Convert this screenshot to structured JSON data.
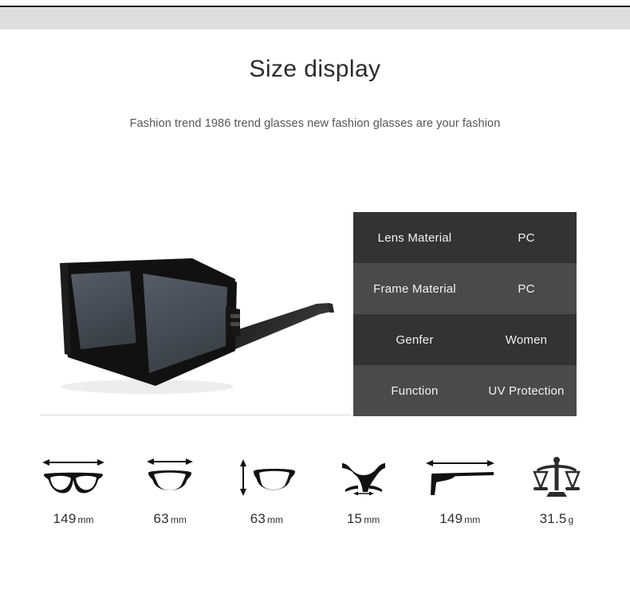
{
  "header": {
    "title": "Size display",
    "subtitle": "Fashion trend 1986 trend glasses new fashion glasses are your fashion"
  },
  "product": {
    "image_alt": "oversized-square-sunglasses",
    "frame_color": "#111111",
    "lens_color": "#4a4f57"
  },
  "spec_table": {
    "rows": [
      {
        "label": "Lens Material",
        "value": "PC",
        "bg": "#333333"
      },
      {
        "label": "Frame Material",
        "value": "PC",
        "bg": "#4a4a4a"
      },
      {
        "label": "Genfer",
        "value": "Women",
        "bg": "#333333"
      },
      {
        "label": "Function",
        "value": "UV Protection",
        "bg": "#4a4a4a"
      }
    ]
  },
  "measurements": [
    {
      "icon": "frame-front-width-icon",
      "number": "149",
      "unit": "mm"
    },
    {
      "icon": "lens-width-icon",
      "number": "63",
      "unit": "mm"
    },
    {
      "icon": "lens-height-icon",
      "number": "63",
      "unit": "mm"
    },
    {
      "icon": "bridge-width-icon",
      "number": "15",
      "unit": "mm"
    },
    {
      "icon": "temple-length-icon",
      "number": "149",
      "unit": "mm"
    },
    {
      "icon": "weight-scale-icon",
      "number": "31.5",
      "unit": "g"
    }
  ]
}
